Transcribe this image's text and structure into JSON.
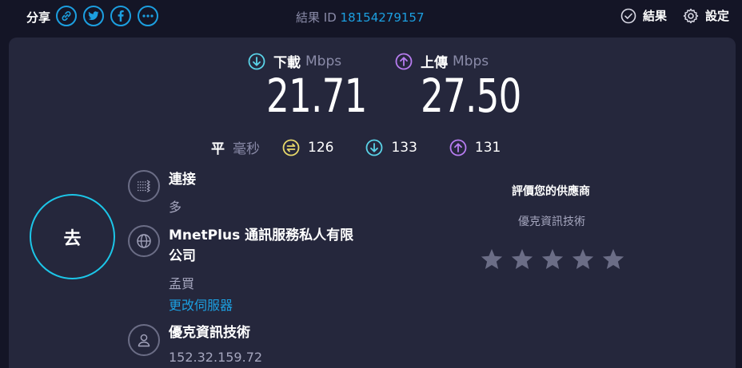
{
  "topbar": {
    "share_label": "分享",
    "share_buttons": [
      {
        "name": "link",
        "icon": "link-icon"
      },
      {
        "name": "twitter",
        "icon": "twitter-icon"
      },
      {
        "name": "facebook",
        "icon": "facebook-icon"
      },
      {
        "name": "more",
        "icon": "more-icon"
      }
    ],
    "result_id_label": "結果 ID",
    "result_id": "18154279157",
    "results_label": "結果",
    "settings_label": "設定"
  },
  "speeds": {
    "download": {
      "label": "下載",
      "unit": "Mbps",
      "value": "21.71",
      "icon": "download-arrow-icon"
    },
    "upload": {
      "label": "上傳",
      "unit": "Mbps",
      "value": "27.50",
      "icon": "upload-arrow-icon"
    }
  },
  "ping": {
    "label": "平",
    "unit": "毫秒",
    "idle": "126",
    "download": "133",
    "upload": "131"
  },
  "go_button": "去",
  "connection": {
    "label": "連接",
    "value": "多"
  },
  "server": {
    "name_line1": "MnetPlus 通訊服務私人有限",
    "name_line2": "公司",
    "location": "孟買",
    "change_link": "更改伺服器"
  },
  "isp": {
    "name": "優克資訊技術",
    "ip": "152.32.159.72"
  },
  "rating": {
    "title": "評價您的供應商",
    "provider": "優克資訊技術",
    "stars": 5
  },
  "colors": {
    "background": "#141526",
    "panel": "#25273c",
    "accent_blue": "#1c9fe0",
    "go_ring": "#1cc6e8",
    "download": "#5ad3e8",
    "upload": "#b77cf0",
    "ping": "#e8d96a",
    "muted": "#8a8ba8",
    "star": "#6b6d86"
  }
}
